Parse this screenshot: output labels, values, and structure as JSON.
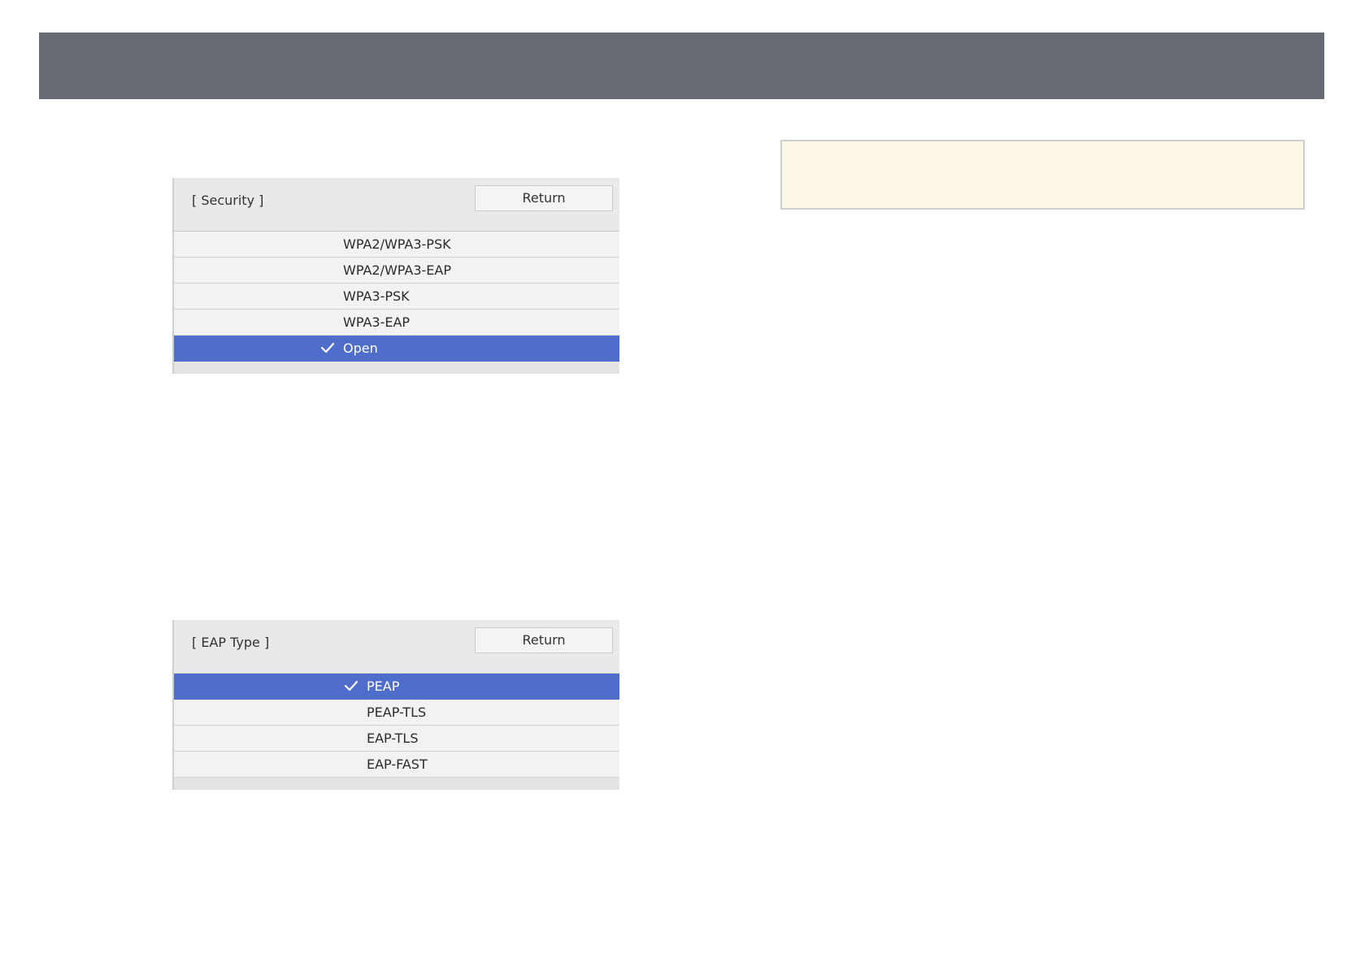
{
  "security": {
    "title": "[ Security ]",
    "return_label": "Return",
    "options": [
      {
        "label": "WPA2/WPA3-PSK",
        "selected": false
      },
      {
        "label": "WPA2/WPA3-EAP",
        "selected": false
      },
      {
        "label": "WPA3-PSK",
        "selected": false
      },
      {
        "label": "WPA3-EAP",
        "selected": false
      },
      {
        "label": "Open",
        "selected": true
      }
    ]
  },
  "eap": {
    "title": "[ EAP Type ]",
    "return_label": "Return",
    "options": [
      {
        "label": "PEAP",
        "selected": true
      },
      {
        "label": "PEAP-TLS",
        "selected": false
      },
      {
        "label": "EAP-TLS",
        "selected": false
      },
      {
        "label": "EAP-FAST",
        "selected": false
      }
    ]
  },
  "colors": {
    "header_bar": "#686b74",
    "selected_row": "#4f6ecb",
    "note_background": "#fdf8e6"
  },
  "icons": {
    "selected_marker": "checkmark-icon"
  }
}
